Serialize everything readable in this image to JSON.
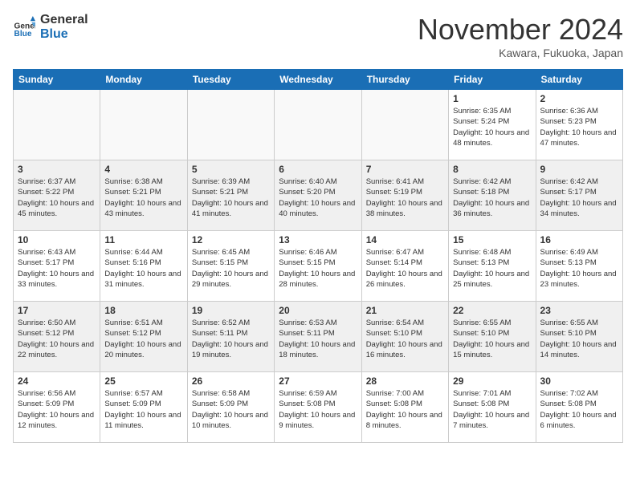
{
  "header": {
    "logo_line1": "General",
    "logo_line2": "Blue",
    "month_title": "November 2024",
    "location": "Kawara, Fukuoka, Japan"
  },
  "weekdays": [
    "Sunday",
    "Monday",
    "Tuesday",
    "Wednesday",
    "Thursday",
    "Friday",
    "Saturday"
  ],
  "weeks": [
    [
      {
        "day": "",
        "info": ""
      },
      {
        "day": "",
        "info": ""
      },
      {
        "day": "",
        "info": ""
      },
      {
        "day": "",
        "info": ""
      },
      {
        "day": "",
        "info": ""
      },
      {
        "day": "1",
        "info": "Sunrise: 6:35 AM\nSunset: 5:24 PM\nDaylight: 10 hours and 48 minutes."
      },
      {
        "day": "2",
        "info": "Sunrise: 6:36 AM\nSunset: 5:23 PM\nDaylight: 10 hours and 47 minutes."
      }
    ],
    [
      {
        "day": "3",
        "info": "Sunrise: 6:37 AM\nSunset: 5:22 PM\nDaylight: 10 hours and 45 minutes."
      },
      {
        "day": "4",
        "info": "Sunrise: 6:38 AM\nSunset: 5:21 PM\nDaylight: 10 hours and 43 minutes."
      },
      {
        "day": "5",
        "info": "Sunrise: 6:39 AM\nSunset: 5:21 PM\nDaylight: 10 hours and 41 minutes."
      },
      {
        "day": "6",
        "info": "Sunrise: 6:40 AM\nSunset: 5:20 PM\nDaylight: 10 hours and 40 minutes."
      },
      {
        "day": "7",
        "info": "Sunrise: 6:41 AM\nSunset: 5:19 PM\nDaylight: 10 hours and 38 minutes."
      },
      {
        "day": "8",
        "info": "Sunrise: 6:42 AM\nSunset: 5:18 PM\nDaylight: 10 hours and 36 minutes."
      },
      {
        "day": "9",
        "info": "Sunrise: 6:42 AM\nSunset: 5:17 PM\nDaylight: 10 hours and 34 minutes."
      }
    ],
    [
      {
        "day": "10",
        "info": "Sunrise: 6:43 AM\nSunset: 5:17 PM\nDaylight: 10 hours and 33 minutes."
      },
      {
        "day": "11",
        "info": "Sunrise: 6:44 AM\nSunset: 5:16 PM\nDaylight: 10 hours and 31 minutes."
      },
      {
        "day": "12",
        "info": "Sunrise: 6:45 AM\nSunset: 5:15 PM\nDaylight: 10 hours and 29 minutes."
      },
      {
        "day": "13",
        "info": "Sunrise: 6:46 AM\nSunset: 5:15 PM\nDaylight: 10 hours and 28 minutes."
      },
      {
        "day": "14",
        "info": "Sunrise: 6:47 AM\nSunset: 5:14 PM\nDaylight: 10 hours and 26 minutes."
      },
      {
        "day": "15",
        "info": "Sunrise: 6:48 AM\nSunset: 5:13 PM\nDaylight: 10 hours and 25 minutes."
      },
      {
        "day": "16",
        "info": "Sunrise: 6:49 AM\nSunset: 5:13 PM\nDaylight: 10 hours and 23 minutes."
      }
    ],
    [
      {
        "day": "17",
        "info": "Sunrise: 6:50 AM\nSunset: 5:12 PM\nDaylight: 10 hours and 22 minutes."
      },
      {
        "day": "18",
        "info": "Sunrise: 6:51 AM\nSunset: 5:12 PM\nDaylight: 10 hours and 20 minutes."
      },
      {
        "day": "19",
        "info": "Sunrise: 6:52 AM\nSunset: 5:11 PM\nDaylight: 10 hours and 19 minutes."
      },
      {
        "day": "20",
        "info": "Sunrise: 6:53 AM\nSunset: 5:11 PM\nDaylight: 10 hours and 18 minutes."
      },
      {
        "day": "21",
        "info": "Sunrise: 6:54 AM\nSunset: 5:10 PM\nDaylight: 10 hours and 16 minutes."
      },
      {
        "day": "22",
        "info": "Sunrise: 6:55 AM\nSunset: 5:10 PM\nDaylight: 10 hours and 15 minutes."
      },
      {
        "day": "23",
        "info": "Sunrise: 6:55 AM\nSunset: 5:10 PM\nDaylight: 10 hours and 14 minutes."
      }
    ],
    [
      {
        "day": "24",
        "info": "Sunrise: 6:56 AM\nSunset: 5:09 PM\nDaylight: 10 hours and 12 minutes."
      },
      {
        "day": "25",
        "info": "Sunrise: 6:57 AM\nSunset: 5:09 PM\nDaylight: 10 hours and 11 minutes."
      },
      {
        "day": "26",
        "info": "Sunrise: 6:58 AM\nSunset: 5:09 PM\nDaylight: 10 hours and 10 minutes."
      },
      {
        "day": "27",
        "info": "Sunrise: 6:59 AM\nSunset: 5:08 PM\nDaylight: 10 hours and 9 minutes."
      },
      {
        "day": "28",
        "info": "Sunrise: 7:00 AM\nSunset: 5:08 PM\nDaylight: 10 hours and 8 minutes."
      },
      {
        "day": "29",
        "info": "Sunrise: 7:01 AM\nSunset: 5:08 PM\nDaylight: 10 hours and 7 minutes."
      },
      {
        "day": "30",
        "info": "Sunrise: 7:02 AM\nSunset: 5:08 PM\nDaylight: 10 hours and 6 minutes."
      }
    ]
  ]
}
